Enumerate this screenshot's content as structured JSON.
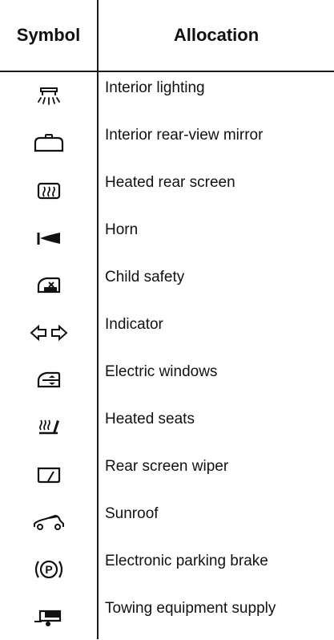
{
  "table": {
    "headers": {
      "symbol": "Symbol",
      "allocation": "Allocation"
    },
    "rows": [
      {
        "icon": "interior-lighting-icon",
        "label": "Interior lighting"
      },
      {
        "icon": "interior-mirror-icon",
        "label": "Interior rear-view mirror"
      },
      {
        "icon": "heated-rear-screen-icon",
        "label": "Heated rear screen"
      },
      {
        "icon": "horn-icon",
        "label": "Horn"
      },
      {
        "icon": "child-safety-icon",
        "label": "Child safety"
      },
      {
        "icon": "indicator-icon",
        "label": "Indicator"
      },
      {
        "icon": "electric-windows-icon",
        "label": "Electric windows"
      },
      {
        "icon": "heated-seats-icon",
        "label": "Heated seats"
      },
      {
        "icon": "rear-screen-wiper-icon",
        "label": "Rear screen wiper"
      },
      {
        "icon": "sunroof-icon",
        "label": "Sunroof"
      },
      {
        "icon": "parking-brake-icon",
        "label": "Electronic parking brake"
      },
      {
        "icon": "towing-supply-icon",
        "label": "Towing equipment supply"
      }
    ]
  }
}
